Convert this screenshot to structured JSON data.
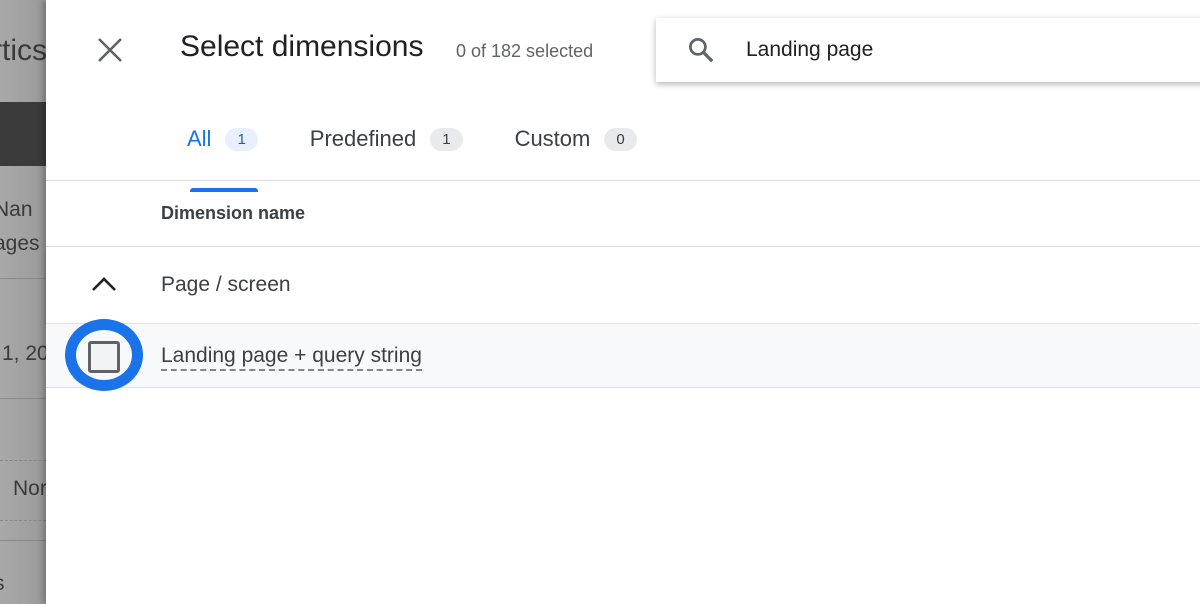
{
  "background": {
    "fragments": [
      "rtics",
      "Nan",
      "ages",
      "1, 20",
      "Nor",
      "s"
    ]
  },
  "dialog": {
    "title": "Select dimensions",
    "selected_count": "0 of 182 selected",
    "search": {
      "value": "Landing page",
      "placeholder": ""
    },
    "tabs": [
      {
        "label": "All",
        "count": "1",
        "active": true
      },
      {
        "label": "Predefined",
        "count": "1"
      },
      {
        "label": "Custom",
        "count": "0"
      }
    ],
    "column_header": "Dimension name",
    "group": {
      "label": "Page / screen",
      "expanded": true
    },
    "items": [
      {
        "label": "Landing page + query string",
        "checked": false
      }
    ]
  },
  "colors": {
    "accent": "#1a73e8",
    "highlight_ring": "#1a73e8"
  }
}
